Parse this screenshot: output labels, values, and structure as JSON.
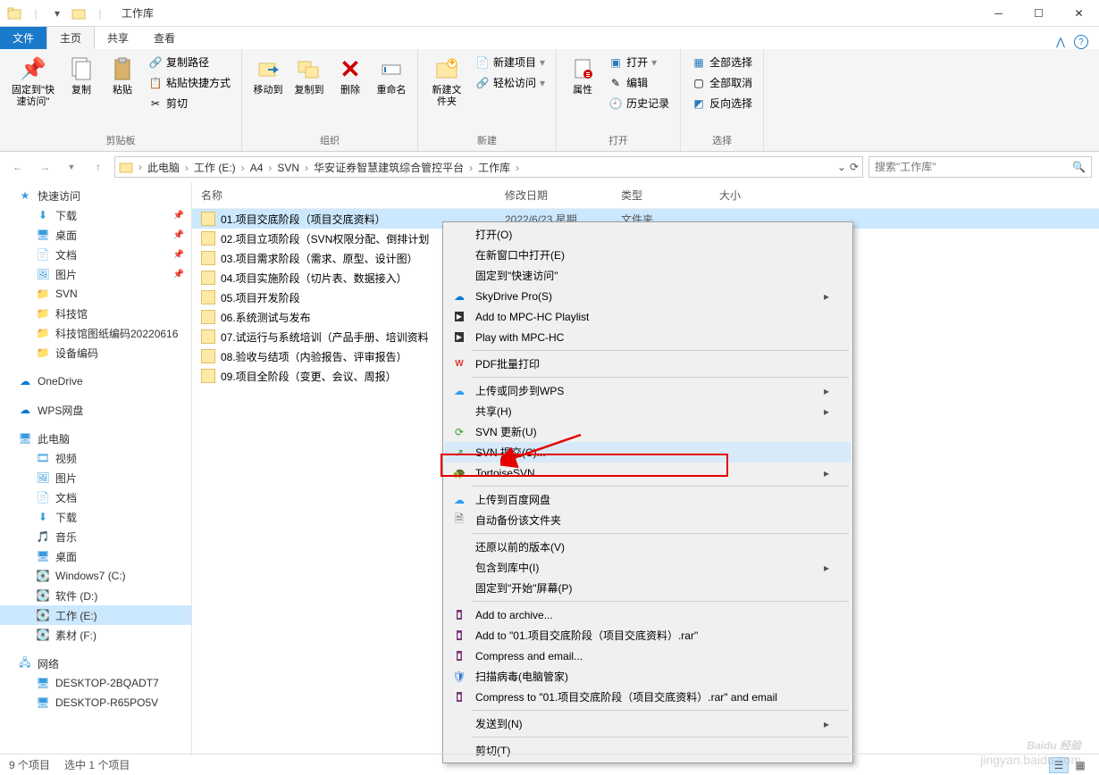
{
  "title": "工作库",
  "tabs": {
    "file": "文件",
    "home": "主页",
    "share": "共享",
    "view": "查看"
  },
  "ribbon": {
    "clipboard": {
      "pin": "固定到\"快速访问\"",
      "copy": "复制",
      "paste": "粘贴",
      "copy_path": "复制路径",
      "paste_shortcut": "粘贴快捷方式",
      "cut": "剪切",
      "label": "剪贴板"
    },
    "organize": {
      "move_to": "移动到",
      "copy_to": "复制到",
      "delete": "删除",
      "rename": "重命名",
      "label": "组织"
    },
    "new": {
      "new_folder": "新建文件夹",
      "new_item": "新建项目",
      "easy_access": "轻松访问",
      "label": "新建"
    },
    "open": {
      "properties": "属性",
      "open": "打开",
      "edit": "编辑",
      "history": "历史记录",
      "label": "打开"
    },
    "select": {
      "select_all": "全部选择",
      "select_none": "全部取消",
      "invert": "反向选择",
      "label": "选择"
    }
  },
  "breadcrumbs": [
    "此电脑",
    "工作 (E:)",
    "A4",
    "SVN",
    "华安证券智慧建筑综合管控平台",
    "工作库"
  ],
  "search_placeholder": "搜索\"工作库\"",
  "columns": {
    "name": "名称",
    "date": "修改日期",
    "type": "类型",
    "size": "大小"
  },
  "files": [
    {
      "name": "01.项目交底阶段（项目交底资料）",
      "date": "2022/6/23 星期",
      "type": "文件夹",
      "selected": true
    },
    {
      "name": "02.项目立项阶段（SVN权限分配、倒排计划",
      "date": "",
      "type": "",
      "selected": false
    },
    {
      "name": "03.项目需求阶段（需求、原型、设计图）",
      "date": "",
      "type": "",
      "selected": false
    },
    {
      "name": "04.项目实施阶段（切片表、数据接入）",
      "date": "",
      "type": "",
      "selected": false
    },
    {
      "name": "05.项目开发阶段",
      "date": "",
      "type": "",
      "selected": false
    },
    {
      "name": "06.系统测试与发布",
      "date": "",
      "type": "",
      "selected": false
    },
    {
      "name": "07.试运行与系统培训（产品手册、培训资料",
      "date": "",
      "type": "",
      "selected": false
    },
    {
      "name": "08.验收与结项（内验报告、评审报告）",
      "date": "",
      "type": "",
      "selected": false
    },
    {
      "name": "09.项目全阶段（变更、会议、周报）",
      "date": "",
      "type": "",
      "selected": false
    }
  ],
  "nav": {
    "quick_access": "快速访问",
    "quick": [
      "下载",
      "桌面",
      "文档",
      "图片",
      "SVN",
      "科技馆",
      "科技馆图纸编码20220616",
      "设备编码"
    ],
    "onedrive": "OneDrive",
    "wps": "WPS网盘",
    "this_pc": "此电脑",
    "pc_items": [
      "视频",
      "图片",
      "文档",
      "下载",
      "音乐",
      "桌面",
      "Windows7 (C:)",
      "软件 (D:)",
      "工作 (E:)",
      "素材 (F:)"
    ],
    "network": "网络",
    "net_items": [
      "DESKTOP-2BQADT7",
      "DESKTOP-R65PO5V"
    ]
  },
  "context_menu": [
    {
      "label": "打开(O)",
      "icon": "",
      "sep": false
    },
    {
      "label": "在新窗口中打开(E)",
      "icon": "",
      "sep": false
    },
    {
      "label": "固定到\"快速访问\"",
      "icon": "",
      "sep": false
    },
    {
      "label": "SkyDrive Pro(S)",
      "icon": "cloud",
      "arrow": true,
      "sep": false
    },
    {
      "label": "Add to MPC-HC Playlist",
      "icon": "mpc",
      "sep": false
    },
    {
      "label": "Play with MPC-HC",
      "icon": "mpc",
      "sep": false
    },
    {
      "sep": true
    },
    {
      "label": "PDF批量打印",
      "icon": "wps-red",
      "sep": false
    },
    {
      "sep": true
    },
    {
      "label": "上传或同步到WPS",
      "icon": "cloud-blue",
      "arrow": true,
      "sep": false
    },
    {
      "label": "共享(H)",
      "icon": "",
      "arrow": true,
      "sep": false
    },
    {
      "label": "SVN 更新(U)",
      "icon": "svn-up",
      "sep": false
    },
    {
      "label": "SVN 提交(C)...",
      "icon": "svn-commit",
      "sep": false,
      "highlight": true
    },
    {
      "label": "TortoiseSVN",
      "icon": "tortoise",
      "arrow": true,
      "sep": false
    },
    {
      "sep": true
    },
    {
      "label": "上传到百度网盘",
      "icon": "baidu",
      "sep": false
    },
    {
      "label": "自动备份该文件夹",
      "icon": "backup",
      "sep": false
    },
    {
      "sep": true
    },
    {
      "label": "还原以前的版本(V)",
      "icon": "",
      "sep": false
    },
    {
      "label": "包含到库中(I)",
      "icon": "",
      "arrow": true,
      "sep": false
    },
    {
      "label": "固定到\"开始\"屏幕(P)",
      "icon": "",
      "sep": false
    },
    {
      "sep": true
    },
    {
      "label": "Add to archive...",
      "icon": "rar",
      "sep": false
    },
    {
      "label": "Add to \"01.项目交底阶段（项目交底资料）.rar\"",
      "icon": "rar",
      "sep": false
    },
    {
      "label": "Compress and email...",
      "icon": "rar",
      "sep": false
    },
    {
      "label": "扫描病毒(电脑管家)",
      "icon": "shield",
      "sep": false
    },
    {
      "label": "Compress to \"01.项目交底阶段（项目交底资料）.rar\" and email",
      "icon": "rar",
      "sep": false
    },
    {
      "sep": true
    },
    {
      "label": "发送到(N)",
      "icon": "",
      "arrow": true,
      "sep": false
    },
    {
      "sep": true
    },
    {
      "label": "剪切(T)",
      "icon": "",
      "sep": false
    }
  ],
  "status": {
    "count": "9 个项目",
    "selected": "选中 1 个项目"
  },
  "watermark": {
    "main": "Baidu 经验",
    "sub": "jingyan.baidu.com"
  }
}
